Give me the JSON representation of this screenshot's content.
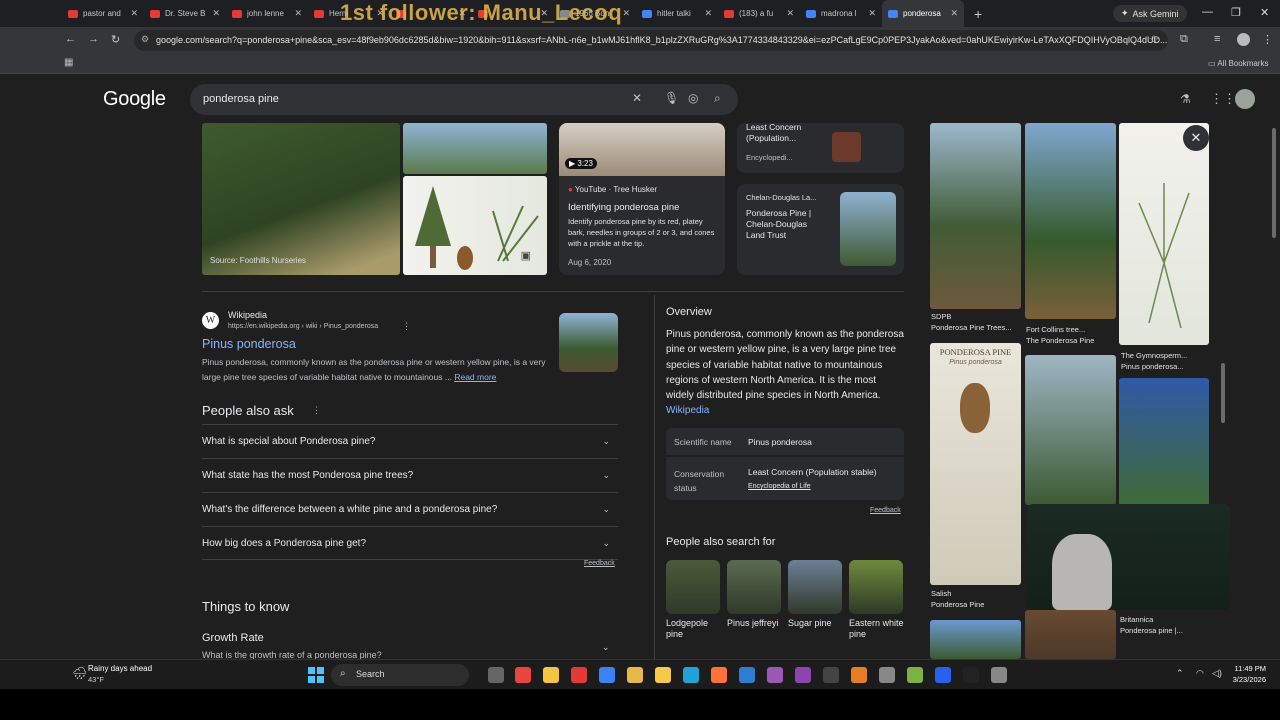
{
  "browser": {
    "tabs": [
      {
        "title": "pastor and",
        "color": "#e53935"
      },
      {
        "title": "Dr. Steve B",
        "color": "#e53935"
      },
      {
        "title": "john lenne",
        "color": "#e53935"
      },
      {
        "title": "Herm",
        "color": "#e53935"
      },
      {
        "title": "",
        "color": "#e53935"
      },
      {
        "title": "",
        "color": "#e53935"
      },
      {
        "title": "1966 Bon",
        "color": "#888"
      },
      {
        "title": "hitler talki",
        "color": "#4285f4"
      },
      {
        "title": "(183) a fu",
        "color": "#e53935"
      },
      {
        "title": "madrona l",
        "color": "#4285f4"
      },
      {
        "title": "ponderosa",
        "color": "#4285f4",
        "active": true
      }
    ],
    "new_tab": "+",
    "gemini_label": "Ask Gemini",
    "overlay_text": "1st follower: Manu_Lecoq",
    "url": "google.com/search?q=ponderosa+pine&sca_esv=48f9eb906dc6285d&biw=1920&bih=911&sxsrf=ANbL-n6e_b1wMJ61hflK8_b1plzZXRuGRg%3A1774334843329&ei=ezPCafLgE9Cp0PEP3JyakAo&ved=0ahUKEwiyirKw-LeTAxXQFDQIHVyOBqlQ4dUD...",
    "all_bookmarks": "All Bookmarks"
  },
  "google": {
    "logo": "Google",
    "query": "ponderosa pine"
  },
  "top_strip": {
    "source_label": "Source: Foothills Nurseries",
    "video_duration": "3:23",
    "video_source": "YouTube · Tree Husker",
    "video_title": "Identifying ponderosa pine",
    "video_desc": "Identify ponderosa pine by its red, platey bark, needles in groups of 2 or 3, and cones with a prickle at the tip.",
    "video_date": "Aug 6, 2020",
    "card_top_title": "Least Concern (Population...",
    "card_top_source": "Encyclopedi...",
    "card_bottom_source": "Chelan-Douglas La...",
    "card_bottom_title": "Ponderosa Pine | Chelan-Douglas Land Trust"
  },
  "wiki_result": {
    "site": "Wikipedia",
    "url": "https://en.wikipedia.org › wiki › Pinus_ponderosa",
    "title": "Pinus ponderosa",
    "snippet": "Pinus ponderosa, commonly known as the ponderosa pine or western yellow pine, is a very large pine tree species of variable habitat native to mountainous ...",
    "read_more": "Read more"
  },
  "people_also_ask": {
    "heading": "People also ask",
    "questions": [
      "What is special about Ponderosa pine?",
      "What state has the most Ponderosa pine trees?",
      "What's the difference between a white pine and a ponderosa pine?",
      "How big does a Ponderosa pine get?"
    ],
    "feedback": "Feedback"
  },
  "things_to_know": {
    "heading": "Things to know",
    "item_title": "Growth Rate",
    "item_sub": "What is the growth rate of a ponderosa pine?"
  },
  "overview": {
    "heading": "Overview",
    "text": "Pinus ponderosa, commonly known as the ponderosa pine or western yellow pine, is a very large pine tree species of variable habitat native to mountainous regions of western North America. It is the most widely distributed pine species in North America.",
    "source_link": "Wikipedia",
    "facts": [
      {
        "label": "Scientific name",
        "value": "Pinus ponderosa",
        "source": ""
      },
      {
        "label": "Conservation status",
        "value": "Least Concern (Population stable)",
        "source": "Encyclopedia of Life"
      }
    ],
    "feedback": "Feedback"
  },
  "people_also_search": {
    "heading": "People also search for",
    "items": [
      {
        "label": "Lodgepole pine",
        "color": "#4a5a3a"
      },
      {
        "label": "Pinus jeffreyi",
        "color": "#5b6b52"
      },
      {
        "label": "Sugar pine",
        "color": "#6c7f98"
      },
      {
        "label": "Eastern white pine",
        "color": "#6f8a3c"
      }
    ]
  },
  "right_images": {
    "captions": [
      {
        "source": "SDPB",
        "title": "Ponderosa Pine Trees..."
      },
      {
        "source": "Fort Collins tree...",
        "title": "The Ponderosa Pine"
      },
      {
        "source": "The Gymnosperm...",
        "title": "Pinus ponderosa..."
      },
      {
        "source": "Salish",
        "title": "Ponderosa Pine"
      },
      {
        "source": "Britannica",
        "title": "Ponderosa pine |..."
      }
    ],
    "book_title": "PONDEROSA PINE",
    "book_sub": "Pinus ponderosa"
  },
  "taskbar": {
    "weather_title": "Rainy days ahead",
    "weather_temp": "43°F",
    "search_label": "Search",
    "time": "11:49 PM",
    "date": "3/23/2026"
  }
}
